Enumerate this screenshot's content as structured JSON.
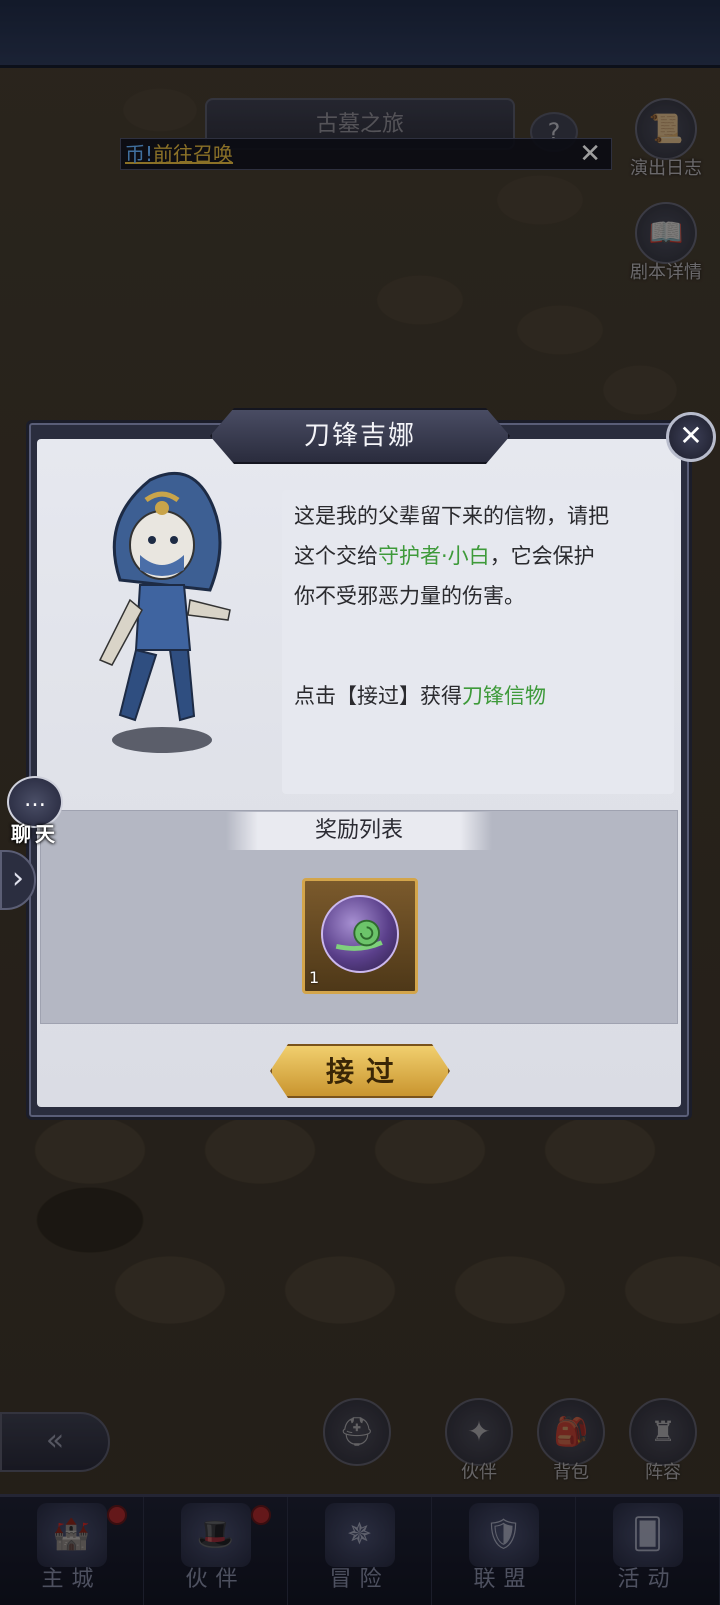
{
  "stage": {
    "title": "古墓之旅",
    "help_icon": "?"
  },
  "notice": {
    "lead": "币!",
    "link": "前往召唤",
    "close_icon": "✕"
  },
  "side_buttons": {
    "log": {
      "label": "演出日志",
      "icon": "scroll-icon"
    },
    "script": {
      "label": "剧本详情",
      "icon": "book-icon"
    }
  },
  "dialog": {
    "title": "刀锋吉娜",
    "close_icon": "✕",
    "speech": {
      "line1": "这是我的父辈留下来的信物，请把",
      "line2_pre": "这个交给",
      "line2_highlight": "守护者·小白",
      "line2_post": "，它会保护",
      "line3": "你不受邪恶力量的伤害。",
      "hint_pre": "点击【接过】获得",
      "hint_highlight": "刀锋信物"
    },
    "reward_title": "奖励列表",
    "rewards": [
      {
        "icon": "snail-orb-icon",
        "count": "1"
      }
    ],
    "accept_label": "接过"
  },
  "chat": {
    "label": "聊天",
    "icon": "…",
    "expand_icon": "›"
  },
  "quick_actions": [
    {
      "label": "",
      "icon": "helmet-icon"
    },
    {
      "label": "伙伴",
      "icon": "partner-icon"
    },
    {
      "label": "背包",
      "icon": "backpack-icon"
    },
    {
      "label": "阵容",
      "icon": "chess-icon"
    }
  ],
  "bottom_nav": [
    {
      "label": "主城",
      "icon": "castle-icon",
      "badge": true
    },
    {
      "label": "伙伴",
      "icon": "wizard-hat-icon",
      "badge": true
    },
    {
      "label": "冒险",
      "icon": "compass-icon",
      "badge": false
    },
    {
      "label": "联盟",
      "icon": "shield-icon",
      "badge": false
    },
    {
      "label": "活动",
      "icon": "cards-icon",
      "badge": false
    }
  ],
  "colors": {
    "highlight_green": "#3e9a3a",
    "notice_gold": "#e0b640",
    "accept_gold": "#e2b552"
  }
}
